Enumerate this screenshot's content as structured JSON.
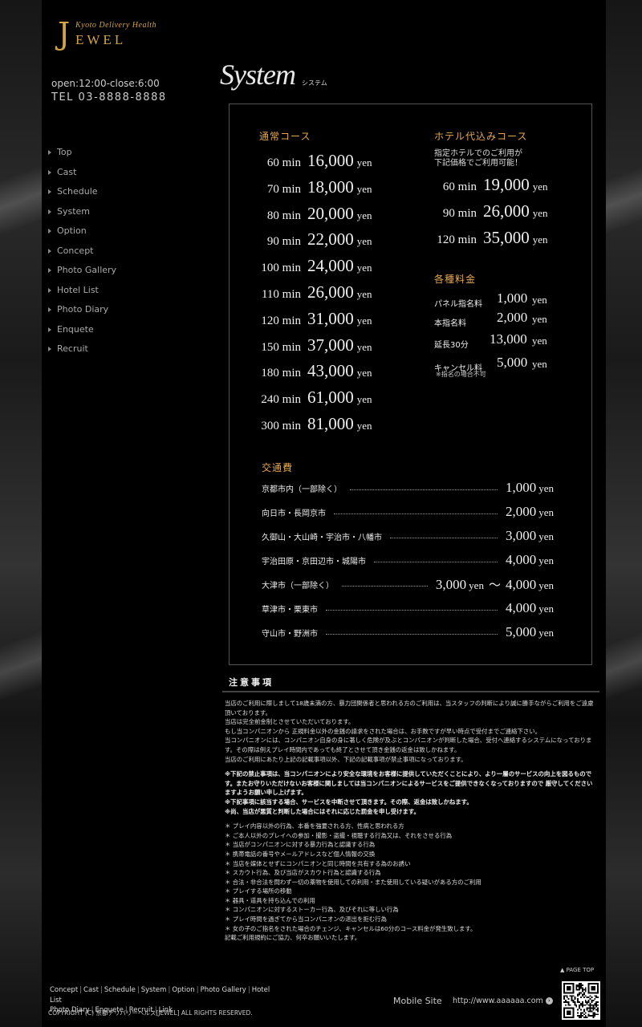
{
  "logo": {
    "initial": "J",
    "subtitle": "Kyoto Delivery Health",
    "name": "EWEL"
  },
  "hours": "open:12:00-close:6:00",
  "tel": "TEL  03-8888-8888",
  "nav": [
    "Top",
    "Cast",
    "Schedule",
    "System",
    "Option",
    "Concept",
    "Photo Gallery",
    "Hotel List",
    "Photo Diary",
    "Enquete",
    "Recruit"
  ],
  "system": {
    "title": "System",
    "subtitle": "システム"
  },
  "normal_course": {
    "heading": "通常コース",
    "rows": [
      {
        "min": "60",
        "price": "16,000"
      },
      {
        "min": "70",
        "price": "18,000"
      },
      {
        "min": "80",
        "price": "20,000"
      },
      {
        "min": "90",
        "price": "22,000"
      },
      {
        "min": "100",
        "price": "24,000"
      },
      {
        "min": "110",
        "price": "26,000"
      },
      {
        "min": "120",
        "price": "31,000"
      },
      {
        "min": "150",
        "price": "37,000"
      },
      {
        "min": "180",
        "price": "43,000"
      },
      {
        "min": "240",
        "price": "61,000"
      },
      {
        "min": "300",
        "price": "81,000"
      }
    ]
  },
  "units": {
    "min": "min",
    "yen": "yen",
    "tilde": "〜"
  },
  "hotel_course": {
    "heading": "ホテル代込みコース",
    "note_line1": "指定ホテルでのご利用が",
    "note_line2": "下記価格でご利用可能！",
    "rows": [
      {
        "min": "60",
        "price": "19,000"
      },
      {
        "min": "90",
        "price": "26,000"
      },
      {
        "min": "120",
        "price": "35,000"
      }
    ]
  },
  "fees": {
    "heading": "各種料金",
    "rows": [
      {
        "label": "パネル指名料",
        "price": "1,000"
      },
      {
        "label": "本指名料",
        "price": "2,000"
      },
      {
        "label": "延長30分",
        "price": "13,000"
      },
      {
        "label": "キャンセル料",
        "price": "5,000",
        "sub": "※指名の場合不可"
      }
    ]
  },
  "transport": {
    "heading": "交通費",
    "rows": [
      {
        "label": "京都市内（一部除く）",
        "price": "1,000"
      },
      {
        "label": "向日市・長岡京市",
        "price": "2,000"
      },
      {
        "label": "久御山・大山崎・宇治市・八幡市",
        "price": "3,000"
      },
      {
        "label": "宇治田原・京田辺市・城陽市",
        "price": "4,000"
      },
      {
        "label": "大津市（一部除く）",
        "price_from": "3,000",
        "price": "4,000"
      },
      {
        "label": "草津市・栗東市",
        "price": "4,000"
      },
      {
        "label": "守山市・野洲市",
        "price": "5,000"
      }
    ]
  },
  "notice": {
    "heading": "注意事項",
    "para1": [
      "当店のご利用に際しまして18歳未満の方、暴力団関係者と思われる方のご利用は、当スタッフの判断により誠に勝手ながらご利用をご遠慮頂いております。",
      "当店は完全前金制とさせていただいております。",
      "もし当コンパニオンから 正規料金以外の金銭の請求をされた場合は、お手数ですが早い時点で受付までご連絡下さい。",
      "当コンパニオンには、コンパニオン自身の身に著しく危険が及ぶとコンパニオンが判断した場合、受付へ連絡するシステムになっております。その際は例えプレイ時間内であっても終了とさせて頂き金銭の返金は致しかねます。",
      "当店のご利用にあたり上記の記載事項以外、下記の記載事項が禁止事項になっております。"
    ],
    "para2": [
      "※下記の禁止事項は、当コンパニオンにより安全な環境をお客様に提供していただくことにより、より一層のサービスの向上を図るものです。またお守りいただけないお客様に関しましては当コンパニオンによるサービスをご提供できなくなっておりますので 厳守してくださいますようお願い申し上げます。",
      "※下記事項に該当する場合、サービスを中断させて頂きます。その際、返金は致しかねます。",
      "※尚、当店が悪質と判断した場合にはそれに応じた罰金を申し受けます。"
    ],
    "list": [
      "＊ プレイ内容以外の行為、本番を強要される方、性病と思われる方",
      "＊ ご本人以外のプレイへの参加・撮影・盗撮・視聴する行為又は、それをさせる行為",
      "＊ 当店がコンパニオンに対する暴力行為と認識する行為",
      "＊ 携帯電話の番号やメールアドレスなど個人情報の交換",
      "＊ 当店を媒体とせずにコンパニオンと同じ時間を共有する為のお誘い",
      "＊ スカウト行為、及び当店がスカウト行為と認識する行為",
      "＊ 合法・非合法を問わず一切の薬物を使用しての利用・また使用している疑いがある方のご利用",
      "＊ プレイする場所の移動",
      "＊ 器具・道具を持ち込んでの利用",
      "＊ コンパニオンに対するストーカー行為、及びそれに等しい行為",
      "＊ プレイ時間を過ぎてから当コンパニオンの退出を拒む行為",
      "＊ 女の子のご指名をされた場合のチェンジ、キャンセルは60分のコース料金が発生致します。",
      "記載ご利用規約にご協力、何卒お願いいたします。"
    ]
  },
  "footer": {
    "page_top": "▲ PAGE TOP",
    "links": [
      "Concept",
      "Cast",
      "Schedule",
      "System",
      "Option",
      "Photo Gallery",
      "Hotel List",
      "Photo Diary",
      "Enquete",
      "Recruit",
      "Link"
    ],
    "copyright": "COPYRIGHT (C) 京都デリバリーヘルス[JEWEL] ALL RIGHTS RESERVED.",
    "mobile_label": "Mobile Site",
    "mobile_url": "http://www.aaaaaa.com",
    "mobile_arrow": "›"
  }
}
